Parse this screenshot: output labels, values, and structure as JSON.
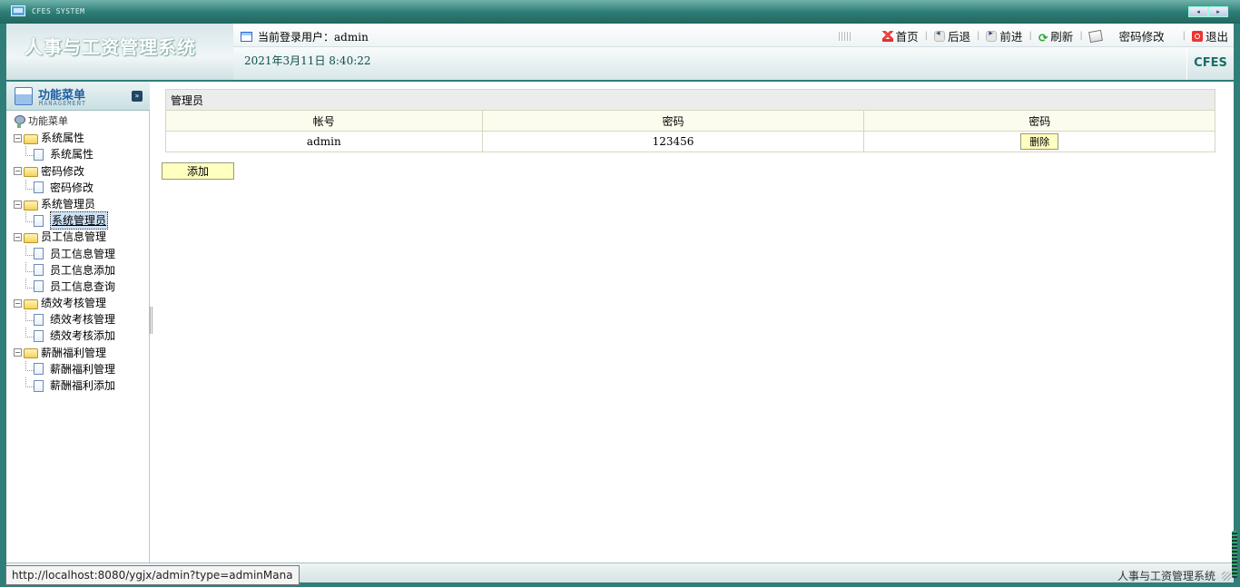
{
  "window": {
    "title": "CFES SYSTEM",
    "prev": "◂",
    "next": "▸"
  },
  "header": {
    "brand": "人事与工资管理系统",
    "user_label": "当前登录用户：",
    "username": "admin",
    "datetime": "2021年3月11日 8:40:22",
    "logo_text": "CFES",
    "links": {
      "home": "首页",
      "back": "后退",
      "forward": "前进",
      "refresh": "刷新",
      "change_password": "密码修改",
      "logout": "退出"
    }
  },
  "sidebar": {
    "title": "功能菜单",
    "subtitle": "MANAGEMENT",
    "root": "功能菜单",
    "groups": [
      {
        "label": "系统属性",
        "items": [
          "系统属性"
        ]
      },
      {
        "label": "密码修改",
        "items": [
          "密码修改"
        ]
      },
      {
        "label": "系统管理员",
        "items": [
          "系统管理员"
        ]
      },
      {
        "label": "员工信息管理",
        "items": [
          "员工信息管理",
          "员工信息添加",
          "员工信息查询"
        ]
      },
      {
        "label": "绩效考核管理",
        "items": [
          "绩效考核管理",
          "绩效考核添加"
        ]
      },
      {
        "label": "薪酬福利管理",
        "items": [
          "薪酬福利管理",
          "薪酬福利添加"
        ]
      }
    ],
    "active": "系统管理员"
  },
  "content": {
    "caption": "管理员",
    "columns": [
      "帐号",
      "密码",
      "密码"
    ],
    "rows": [
      {
        "account": "admin",
        "password": "123456",
        "action": "删除"
      }
    ],
    "add_button": "添加"
  },
  "statusbar": {
    "url": "http://localhost:8080/ygjx/admin?type=adminMana",
    "system_name": "人事与工资管理系统"
  }
}
